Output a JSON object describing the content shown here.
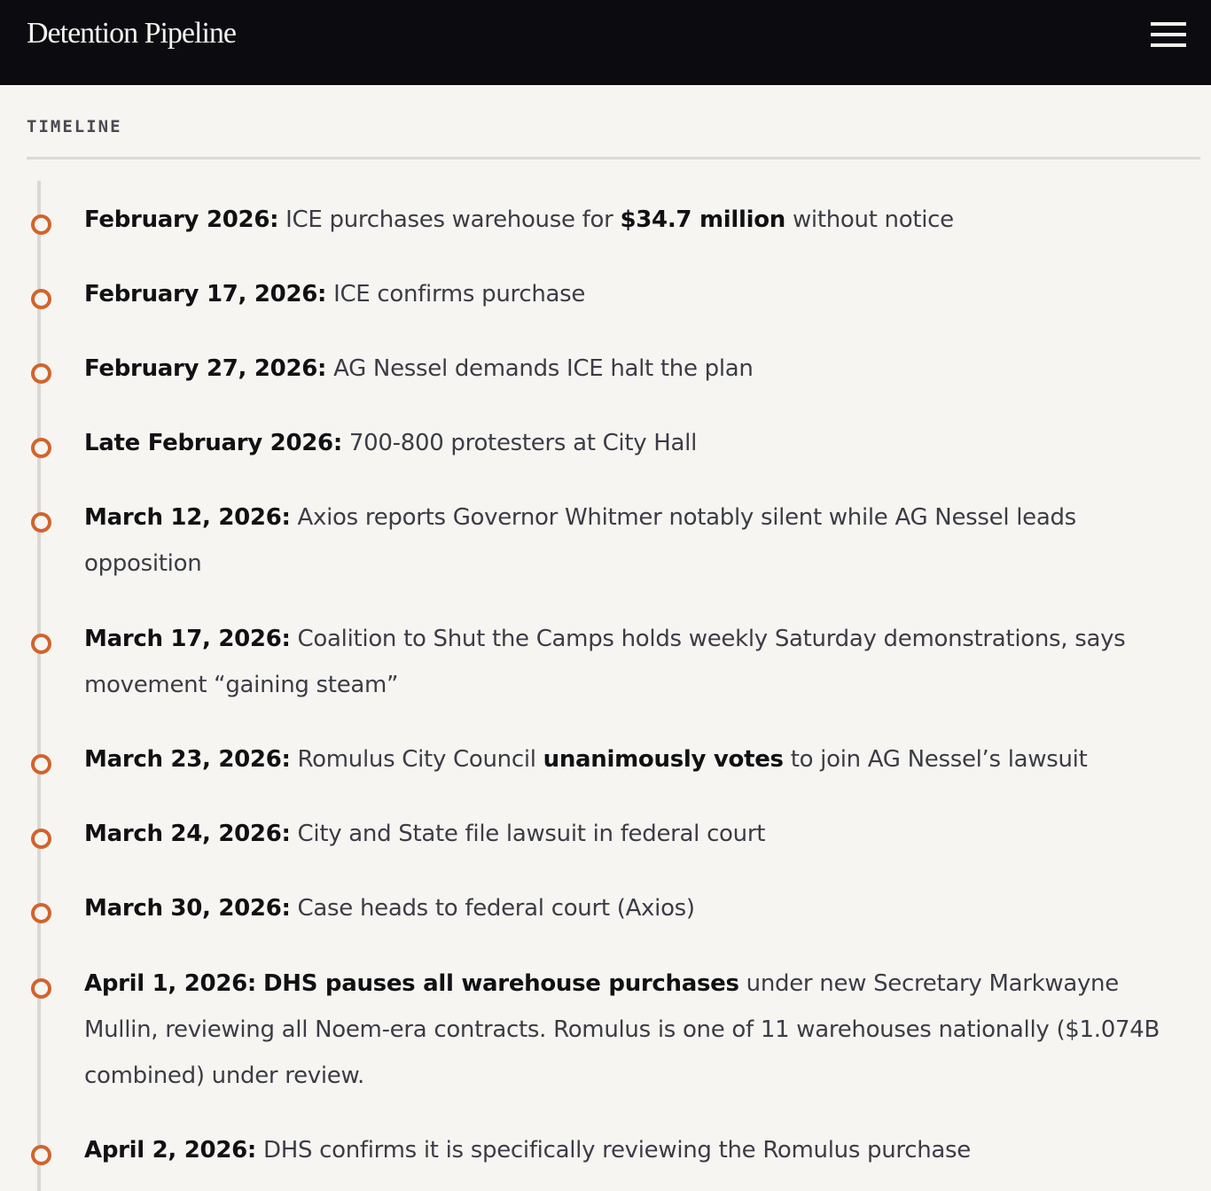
{
  "header": {
    "title": "Detention Pipeline",
    "menu_icon": "hamburger-menu-icon"
  },
  "section": {
    "label": "TIMELINE"
  },
  "colors": {
    "header_bg": "#0b0b10",
    "page_bg": "#f7f5f1",
    "accent": "#d2632d",
    "timeline_line": "#d9d7d2"
  },
  "timeline": [
    {
      "date": "February 2026:",
      "t1": " ICE purchases warehouse for ",
      "b1": "$34.7 million",
      "t2": " without notice"
    },
    {
      "date": "February 17, 2026:",
      "t1": " ICE confirms purchase"
    },
    {
      "date": "February 27, 2026:",
      "t1": " AG Nessel demands ICE halt the plan"
    },
    {
      "date": "Late February 2026:",
      "t1": " 700-800 protesters at City Hall"
    },
    {
      "date": "March 12, 2026:",
      "t1": " Axios reports Governor Whitmer notably silent while AG Nessel leads opposition"
    },
    {
      "date": "March 17, 2026:",
      "t1": " Coalition to Shut the Camps holds weekly Saturday demonstrations, says movement “gaining steam”"
    },
    {
      "date": "March 23, 2026:",
      "t1": " Romulus City Council ",
      "b1": "unanimously votes",
      "t2": " to join AG Nessel’s lawsuit"
    },
    {
      "date": "March 24, 2026:",
      "t1": " City and State file lawsuit in federal court"
    },
    {
      "date": "March 30, 2026:",
      "t1": " Case heads to federal court (Axios)"
    },
    {
      "date": "April 1, 2026:",
      "t1": " ",
      "b1": "DHS pauses all warehouse purchases",
      "t2": " under new Secretary Markwayne Mullin, reviewing all Noem-era contracts. Romulus is one of 11 warehouses nationally ($1.074B combined) under review."
    },
    {
      "date": "April 2, 2026:",
      "t1": " DHS confirms it is specifically reviewing the Romulus purchase"
    }
  ]
}
